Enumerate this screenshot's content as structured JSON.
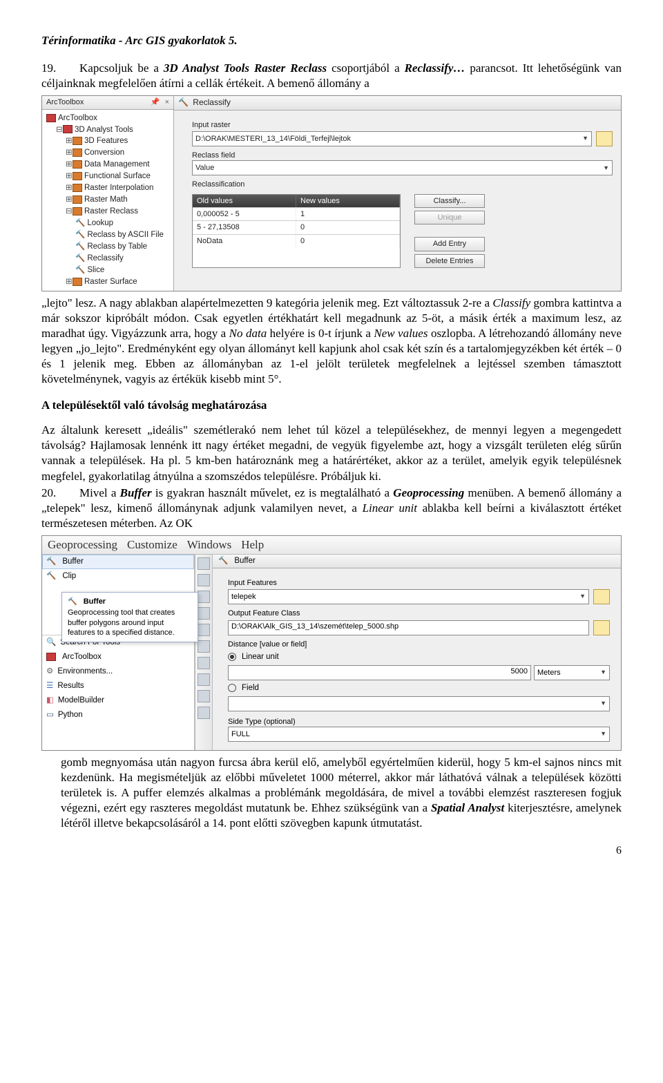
{
  "doc": {
    "header": "Térinformatika - Arc GIS gyakorlatok 5.",
    "p19a": "19.",
    "p19b": "Kapcsoljuk be a ",
    "p19c": "3D Analyst Tools Raster Reclass",
    "p19d": " csoportjából a ",
    "p19e": "Reclassify…",
    "p19f": " parancsot. Itt lehetőségünk van céljainknak megfelelően átírni a cellák értékeit. A bemenő állomány a",
    "after_rc_1": "„lejto\" lesz. A nagy ablakban alapértelmezetten 9 kategória jelenik meg. Ezt változtassuk 2-re a ",
    "after_rc_2": "Classify",
    "after_rc_3": " gombra kattintva a már sokszor kipróbált módon. Csak egyetlen értékhatárt kell megadnunk az 5-öt, a másik érték a maximum lesz, az maradhat úgy. Vigyázzunk arra, hogy a ",
    "after_rc_4": "No data",
    "after_rc_5": " helyére is 0-t írjunk a ",
    "after_rc_6": "New values",
    "after_rc_7": " oszlopba. A létrehozandó állomány neve legyen „jo_lejto\". Eredményként egy olyan állományt kell kapjunk ahol csak két szín és a tartalomjegyzékben két érték – 0 és 1 jelenik meg. Ebben az állományban az 1-el jelölt területek megfelelnek a lejtéssel szemben támasztott követelménynek, vagyis az értékük kisebb mint 5°.",
    "sec2_title": "A településektől való távolság meghatározása",
    "sec2_p1": "Az általunk keresett „ideális\" szemétlerakó nem lehet túl közel a településekhez, de mennyi legyen a megengedett távolság? Hajlamosak lennénk itt nagy értéket megadni, de vegyük figyelembe azt, hogy a vizsgált területen elég sűrűn vannak a települések. Ha pl. 5 km-ben határoznánk meg a határértéket, akkor az a terület, amelyik egyik településnek megfelel, gyakorlatilag átnyúlna a szomszédos településre. Próbáljuk ki.",
    "p20a": "20.",
    "p20b": "Mivel a ",
    "p20c": "Buffer",
    "p20d": " is gyakran használt művelet, ez is megtalálható a ",
    "p20e": "Geoprocessing",
    "p20f": " menüben. A bemenő állomány a „telepek\" lesz, kimenő állománynak adjunk valamilyen nevet, a ",
    "p20g": "Linear unit",
    "p20h": " ablakba kell beírni a kiválasztott értéket természetesen méterben. Az OK",
    "after_buf": "gomb megnyomása után nagyon furcsa ábra kerül elő, amelyből egyértelműen kiderül, hogy 5 km-el sajnos nincs mit kezdenünk. Ha megismételjük az előbbi műveletet 1000 méterrel, akkor már láthatóvá válnak a települések közötti területek is. A puffer elemzés alkalmas a problémánk megoldására, de mivel a további elemzést raszteresen fogjuk végezni, ezért egy raszteres megoldást mutatunk be. Ehhez szükségünk van a ",
    "after_buf_b": "Spatial Analyst",
    "after_buf_c": " kiterjesztésre, amelynek létéről illetve bekapcsolásáról a 14. pont előtti szövegben kapunk útmutatást.",
    "pagenum": "6"
  },
  "rc": {
    "panel_title": "ArcToolbox",
    "pin": "📌",
    "close": "×",
    "tree": {
      "root": "ArcToolbox",
      "n1": "3D Analyst Tools",
      "n1a": "3D Features",
      "n1b": "Conversion",
      "n1c": "Data Management",
      "n1d": "Functional Surface",
      "n1e": "Raster Interpolation",
      "n1f": "Raster Math",
      "n1g": "Raster Reclass",
      "n1g1": "Lookup",
      "n1g2": "Reclass by ASCII File",
      "n1g3": "Reclass by Table",
      "n1g4": "Reclassify",
      "n1g5": "Slice",
      "n1h": "Raster Surface"
    },
    "dlg_title": "Reclassify",
    "lbl_input": "Input raster",
    "val_input": "D:\\ORAK\\MESTERI_13_14\\Földi_Terfejl\\lejtok",
    "lbl_field": "Reclass field",
    "val_field": "Value",
    "lbl_reclass": "Reclassification",
    "th_old": "Old values",
    "th_new": "New values",
    "rows": [
      {
        "old": "0,000052 - 5",
        "new": "1"
      },
      {
        "old": "5 - 27,13508",
        "new": "0"
      },
      {
        "old": "NoData",
        "new": "0"
      }
    ],
    "btn_classify": "Classify...",
    "btn_unique": "Unique",
    "btn_add": "Add Entry",
    "btn_del": "Delete Entries"
  },
  "buf": {
    "menus": [
      "Geoprocessing",
      "Customize",
      "Windows",
      "Help"
    ],
    "left_items": [
      "Buffer",
      "Clip"
    ],
    "tooltip_title": "Buffer",
    "tooltip_text": "Geoprocessing tool that creates buffer polygons around input features to a specified distance.",
    "left_rest": [
      "Search For Tools",
      "ArcToolbox",
      "Environments...",
      "Results",
      "ModelBuilder",
      "Python"
    ],
    "dlg_title": "Buffer",
    "lbl_inf": "Input Features",
    "val_inf": "telepek",
    "lbl_outf": "Output Feature Class",
    "val_outf": "D:\\ORAK\\Alk_GIS_13_14\\szemét\\telep_5000.shp",
    "lbl_dist": "Distance [value or field]",
    "opt_linear": "Linear unit",
    "val_dist": "5000",
    "unit": "Meters",
    "opt_field": "Field",
    "lbl_side": "Side Type (optional)",
    "val_side": "FULL"
  }
}
